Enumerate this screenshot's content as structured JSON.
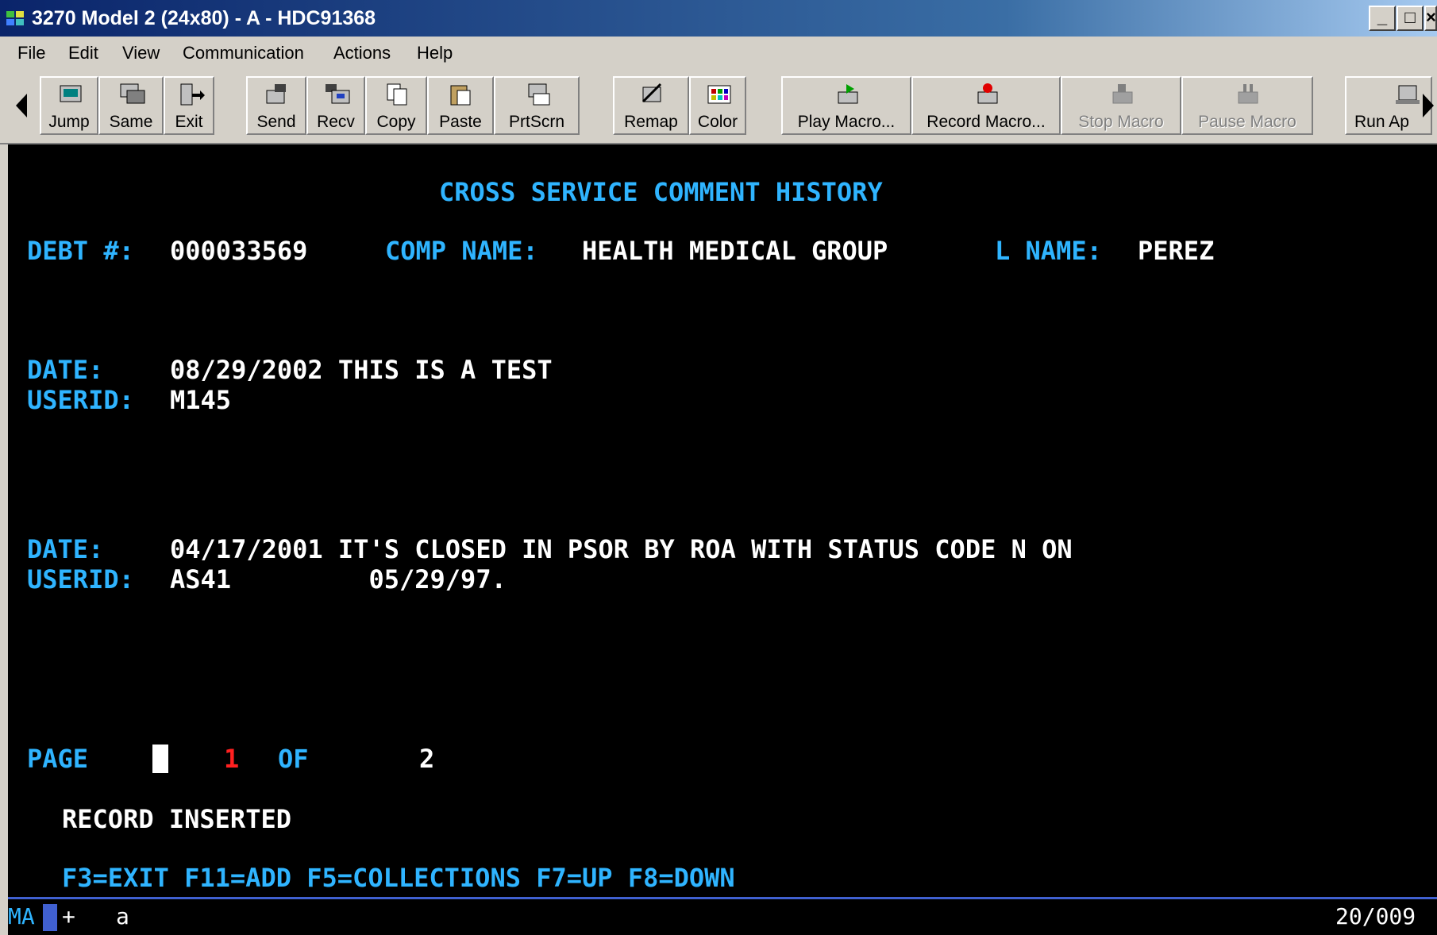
{
  "window": {
    "title": "3270 Model 2 (24x80) - A - HDC91368",
    "minimize": "_",
    "maximize": "□",
    "close": "×"
  },
  "menu": [
    "File",
    "Edit",
    "View",
    "Communication",
    "Actions",
    "Help"
  ],
  "toolbar": {
    "jump": "Jump",
    "same": "Same",
    "exit": "Exit",
    "send": "Send",
    "recv": "Recv",
    "copy": "Copy",
    "paste": "Paste",
    "prtscrn": "PrtScrn",
    "remap": "Remap",
    "color": "Color",
    "play_macro": "Play Macro...",
    "record_macro": "Record Macro...",
    "stop_macro": "Stop Macro",
    "pause_macro": "Pause Macro",
    "run_app": "Run Ap"
  },
  "screen": {
    "title": "CROSS SERVICE COMMENT HISTORY",
    "debt_label": "DEBT #:",
    "debt_value": "000033569",
    "comp_label": "COMP NAME:",
    "comp_value": "HEALTH MEDICAL GROUP",
    "lname_label": "L NAME:",
    "lname_value": "PEREZ",
    "entries": [
      {
        "date_label": "DATE:",
        "date_text": "08/29/2002 THIS IS A TEST",
        "userid_label": "USERID:",
        "userid_text": "M145"
      },
      {
        "date_label": "DATE:",
        "date_text": "04/17/2001 IT'S CLOSED IN PSOR BY ROA WITH STATUS CODE N ON",
        "userid_label": "USERID:",
        "userid_text": "AS41         05/29/97."
      }
    ],
    "page_label": "PAGE",
    "page_current": "1",
    "of_label": "OF",
    "page_total": "2",
    "message": "RECORD INSERTED",
    "function_keys": "F3=EXIT F11=ADD F5=COLLECTIONS F7=UP F8=DOWN"
  },
  "status": {
    "mode": "MA",
    "indicator": "+",
    "input": "a",
    "position": "20/009"
  }
}
